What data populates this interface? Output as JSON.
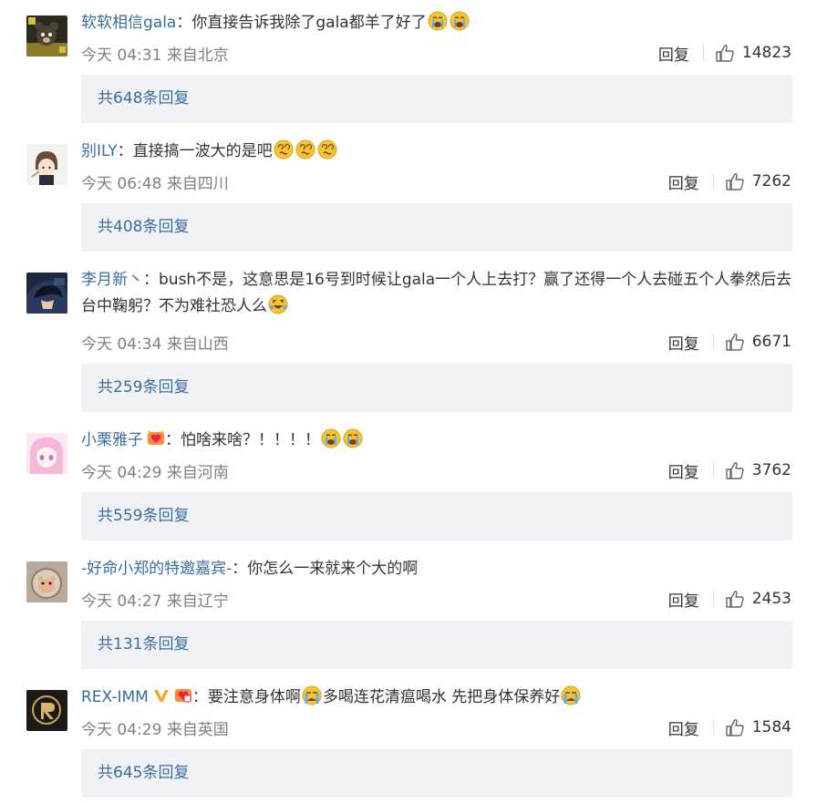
{
  "comments": [
    {
      "user": "软软相信gala",
      "sep": "：",
      "text": "你直接告诉我除了gala都羊了好了",
      "emojis": [
        "cry",
        "cry"
      ],
      "badges": [],
      "time": "今天 04:31",
      "location": "来自北京",
      "reply_label": "回复",
      "likes": "14823",
      "replies": "共648条回复",
      "avatar_icon": "bear-avatar-icon"
    },
    {
      "user": "别ILY",
      "sep": "：",
      "text": "直接搞一波大的是吧",
      "emojis": [
        "dizzy",
        "dizzy",
        "dizzy"
      ],
      "badges": [],
      "time": "今天 06:48",
      "location": "来自四川",
      "reply_label": "回复",
      "likes": "7262",
      "replies": "共408条回复",
      "avatar_icon": "chibi-avatar-icon"
    },
    {
      "user": "李月新丶",
      "sep": "：",
      "text": "bush不是，这意思是16号到时候让gala一个人上去打？赢了还得一个人去碰五个人拳然后去台中鞠躬？不为难社恐人么",
      "emojis": [
        "laugh-cry"
      ],
      "badges": [],
      "time": "今天 04:34",
      "location": "来自山西",
      "reply_label": "回复",
      "likes": "6671",
      "replies": "共259条回复",
      "avatar_icon": "anime-boy-avatar-icon"
    },
    {
      "user": "小栗雅子",
      "sep": "：",
      "text": "怕啥来啥？！！！！",
      "emojis": [
        "cry",
        "cry"
      ],
      "badges": [
        "heart-badge"
      ],
      "time": "今天 04:29",
      "location": "来自河南",
      "reply_label": "回复",
      "likes": "3762",
      "replies": "共559条回复",
      "avatar_icon": "pink-anime-avatar-icon"
    },
    {
      "user": "-好命小郑的特邀嘉宾-",
      "sep": "：",
      "text": "你怎么一来就来个大的啊",
      "emojis": [],
      "badges": [],
      "time": "今天 04:27",
      "location": "来自辽宁",
      "reply_label": "回复",
      "likes": "2453",
      "replies": "共131条回复",
      "avatar_icon": "hamster-avatar-icon"
    },
    {
      "user": "REX-IMM",
      "sep": "：",
      "text_parts": [
        "要注意身体啊",
        "多喝连花清瘟喝水 先把身体保养好"
      ],
      "emojis": [
        "sob",
        "sob"
      ],
      "badges": [
        "verified-v-badge",
        "member-badge"
      ],
      "time": "今天 04:29",
      "location": "来自英国",
      "reply_label": "回复",
      "likes": "1584",
      "replies": "共645条回复",
      "avatar_icon": "gold-emblem-avatar-icon"
    }
  ],
  "colors": {
    "link": "#3a6d9f",
    "meta": "#808080",
    "reply_bar": "#f1f2f5",
    "emoji": "#f7c531"
  }
}
